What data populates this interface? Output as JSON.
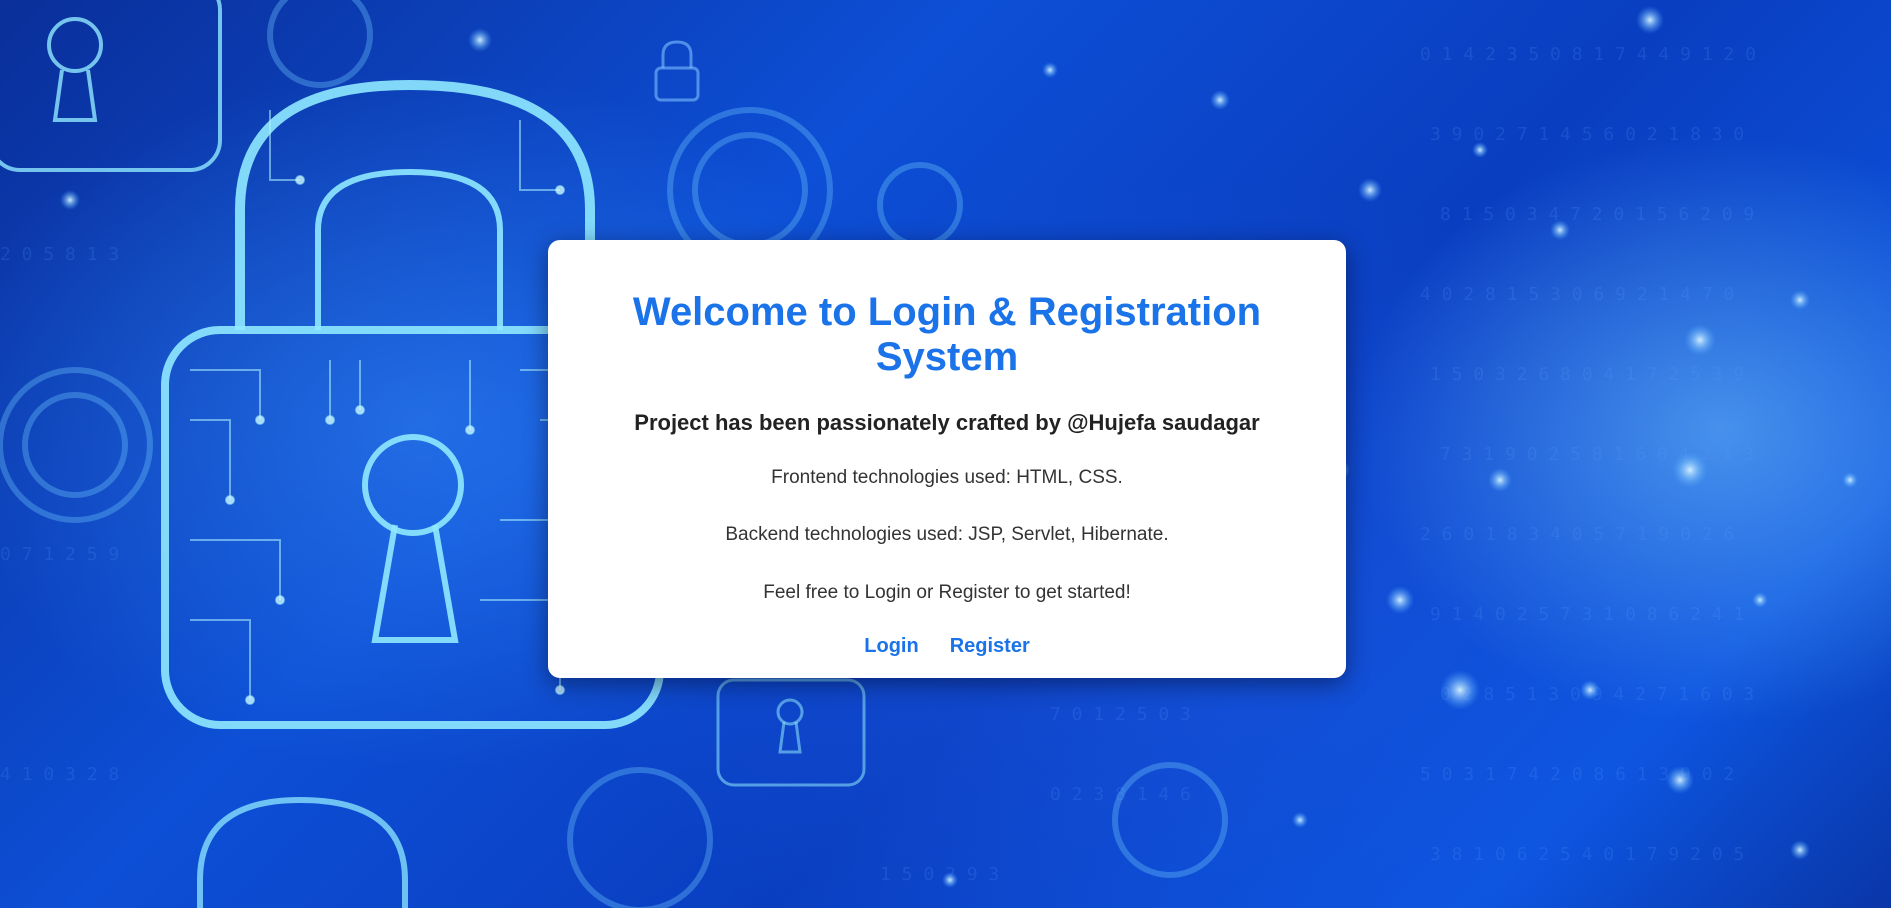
{
  "page": {
    "title": "Welcome to Login & Registration System",
    "subtitle": "Project has been passionately crafted by @Hujefa saudagar",
    "paragraphs": [
      "Frontend technologies used: HTML, CSS.",
      "Backend technologies used: JSP, Servlet, Hibernate.",
      "Feel free to Login or Register to get started!"
    ],
    "links": {
      "login": "Login",
      "register": "Register"
    }
  },
  "background": {
    "theme": "blue-cyber-security-padlocks",
    "icons": [
      "padlock-icon",
      "keyhole-icon"
    ]
  },
  "colors": {
    "accent": "#1a73e8",
    "card": "#ffffff",
    "text": "#333333",
    "background": "#0d4fd6"
  }
}
